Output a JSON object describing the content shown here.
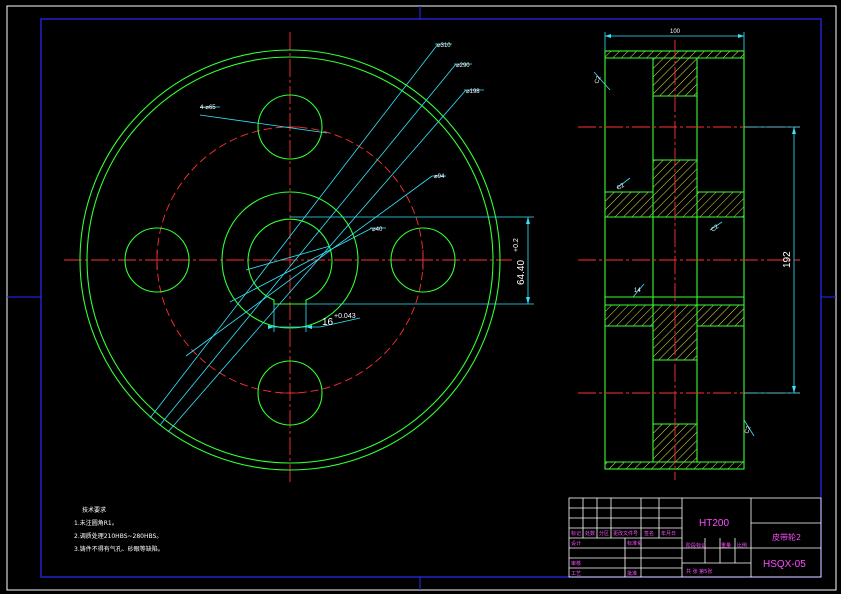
{
  "dimensions": {
    "front": {
      "dia_outer": "⌀310",
      "dia_290": "⌀290",
      "dia_198": "⌀198",
      "holes": "4-⌀65",
      "dia_94": "⌀94",
      "dia_40": "⌀40",
      "keyway_depth": "64.40",
      "keyway_depth_tol": "+0.2",
      "keyway_width": "16",
      "keyway_width_tol": "+0.043"
    },
    "section": {
      "width": "100",
      "height": "192",
      "chamfer_top": "C2",
      "chamfer_left": "C2",
      "chamfer_mid": "C2",
      "chamfer_hub": "14",
      "chamfer_bottom": "C2"
    }
  },
  "notes": {
    "heading": "技术要求",
    "items": [
      "1.未注圆角R1。",
      "2.调质处理210HBS~280HBS。",
      "3.铸件不得有气孔、砂眼等缺陷。"
    ]
  },
  "title_block": {
    "material": "HT200",
    "part_name": "皮带轮2",
    "drawing_no": "HSQX-05",
    "labels": {
      "mark": "标记",
      "count": "处数",
      "zone": "分区",
      "change_doc": "更改文件号",
      "sign": "签名",
      "date": "年月日",
      "design": "设计",
      "standardize": "标准化",
      "stage_mark": "阶段标记",
      "weight": "重量",
      "scale": "比例",
      "check": "审核",
      "process": "工艺",
      "approve": "批准",
      "sheets": "共  张  第5张"
    }
  }
}
